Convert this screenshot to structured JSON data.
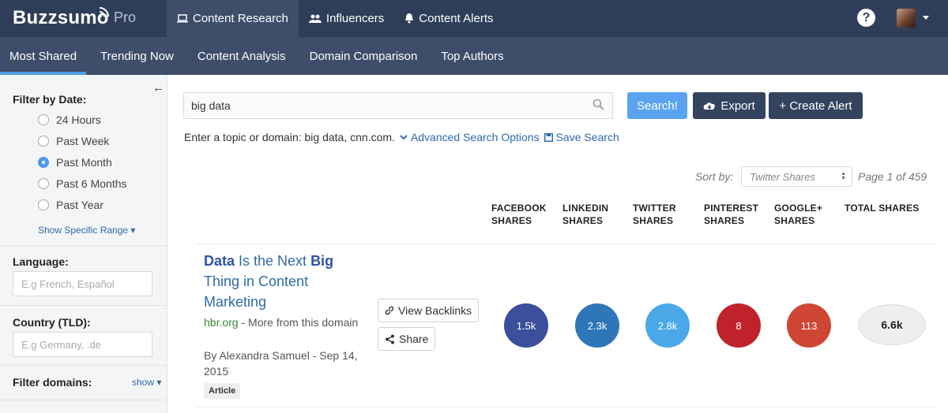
{
  "brand": {
    "logo": "Buzzsumo",
    "tier": "Pro"
  },
  "topnav": [
    {
      "label": "Content Research",
      "active": true
    },
    {
      "label": "Influencers",
      "active": false
    },
    {
      "label": "Content Alerts",
      "active": false
    }
  ],
  "header": {
    "help": "?"
  },
  "subnav": [
    {
      "label": "Most Shared",
      "active": true
    },
    {
      "label": "Trending Now"
    },
    {
      "label": "Content Analysis"
    },
    {
      "label": "Domain Comparison"
    },
    {
      "label": "Top Authors"
    }
  ],
  "sidebar": {
    "date_label": "Filter by Date:",
    "date_options": [
      {
        "label": "24 Hours",
        "checked": false
      },
      {
        "label": "Past Week",
        "checked": false
      },
      {
        "label": "Past Month",
        "checked": true
      },
      {
        "label": "Past 6 Months",
        "checked": false
      },
      {
        "label": "Past Year",
        "checked": false
      }
    ],
    "show_range": "Show Specific Range ▾",
    "language_label": "Language:",
    "language_placeholder": "E.g French, Español",
    "country_label": "Country (TLD):",
    "country_placeholder": "E.g Germany, .de",
    "domains_label": "Filter domains:",
    "domains_show": "show ▾"
  },
  "search": {
    "query": "big data",
    "search_button": "Search!",
    "export_button": "Export",
    "alert_button": "+ Create Alert",
    "hint": "Enter a topic or domain: big data, cnn.com.",
    "advanced": "Advanced Search Options",
    "save": "Save Search"
  },
  "sort": {
    "label": "Sort by:",
    "value": "Twitter Shares",
    "page": "Page 1 of 459"
  },
  "columns": [
    {
      "line1": "FACEBOOK",
      "line2": "SHARES"
    },
    {
      "line1": "LINKEDIN",
      "line2": "SHARES"
    },
    {
      "line1": "TWITTER",
      "line2": "SHARES"
    },
    {
      "line1": "PINTEREST",
      "line2": "SHARES"
    },
    {
      "line1": "GOOGLE+",
      "line2": "SHARES"
    },
    {
      "line1": "TOTAL SHARES",
      "line2": ""
    }
  ],
  "result": {
    "title_part1": "Data",
    "title_part2": " Is the Next ",
    "title_part3": "Big",
    "title_part4": " Thing in Content Marketing",
    "domain": "hbr.org",
    "more": " - More from this domain",
    "author": "By Alexandra Samuel",
    "date": " - Sep 14, 2015",
    "type": "Article",
    "backlinks_button": "View Backlinks",
    "share_button": "Share",
    "shares": {
      "facebook": "1.5k",
      "linkedin": "2.3k",
      "twitter": "2.8k",
      "pinterest": "8",
      "googleplus": "113",
      "total": "6.6k"
    },
    "colors": {
      "facebook": "#3b4f9c",
      "linkedin": "#2f76b8",
      "twitter": "#4aa8e8",
      "pinterest": "#c0222b",
      "googleplus": "#cf4634"
    }
  }
}
